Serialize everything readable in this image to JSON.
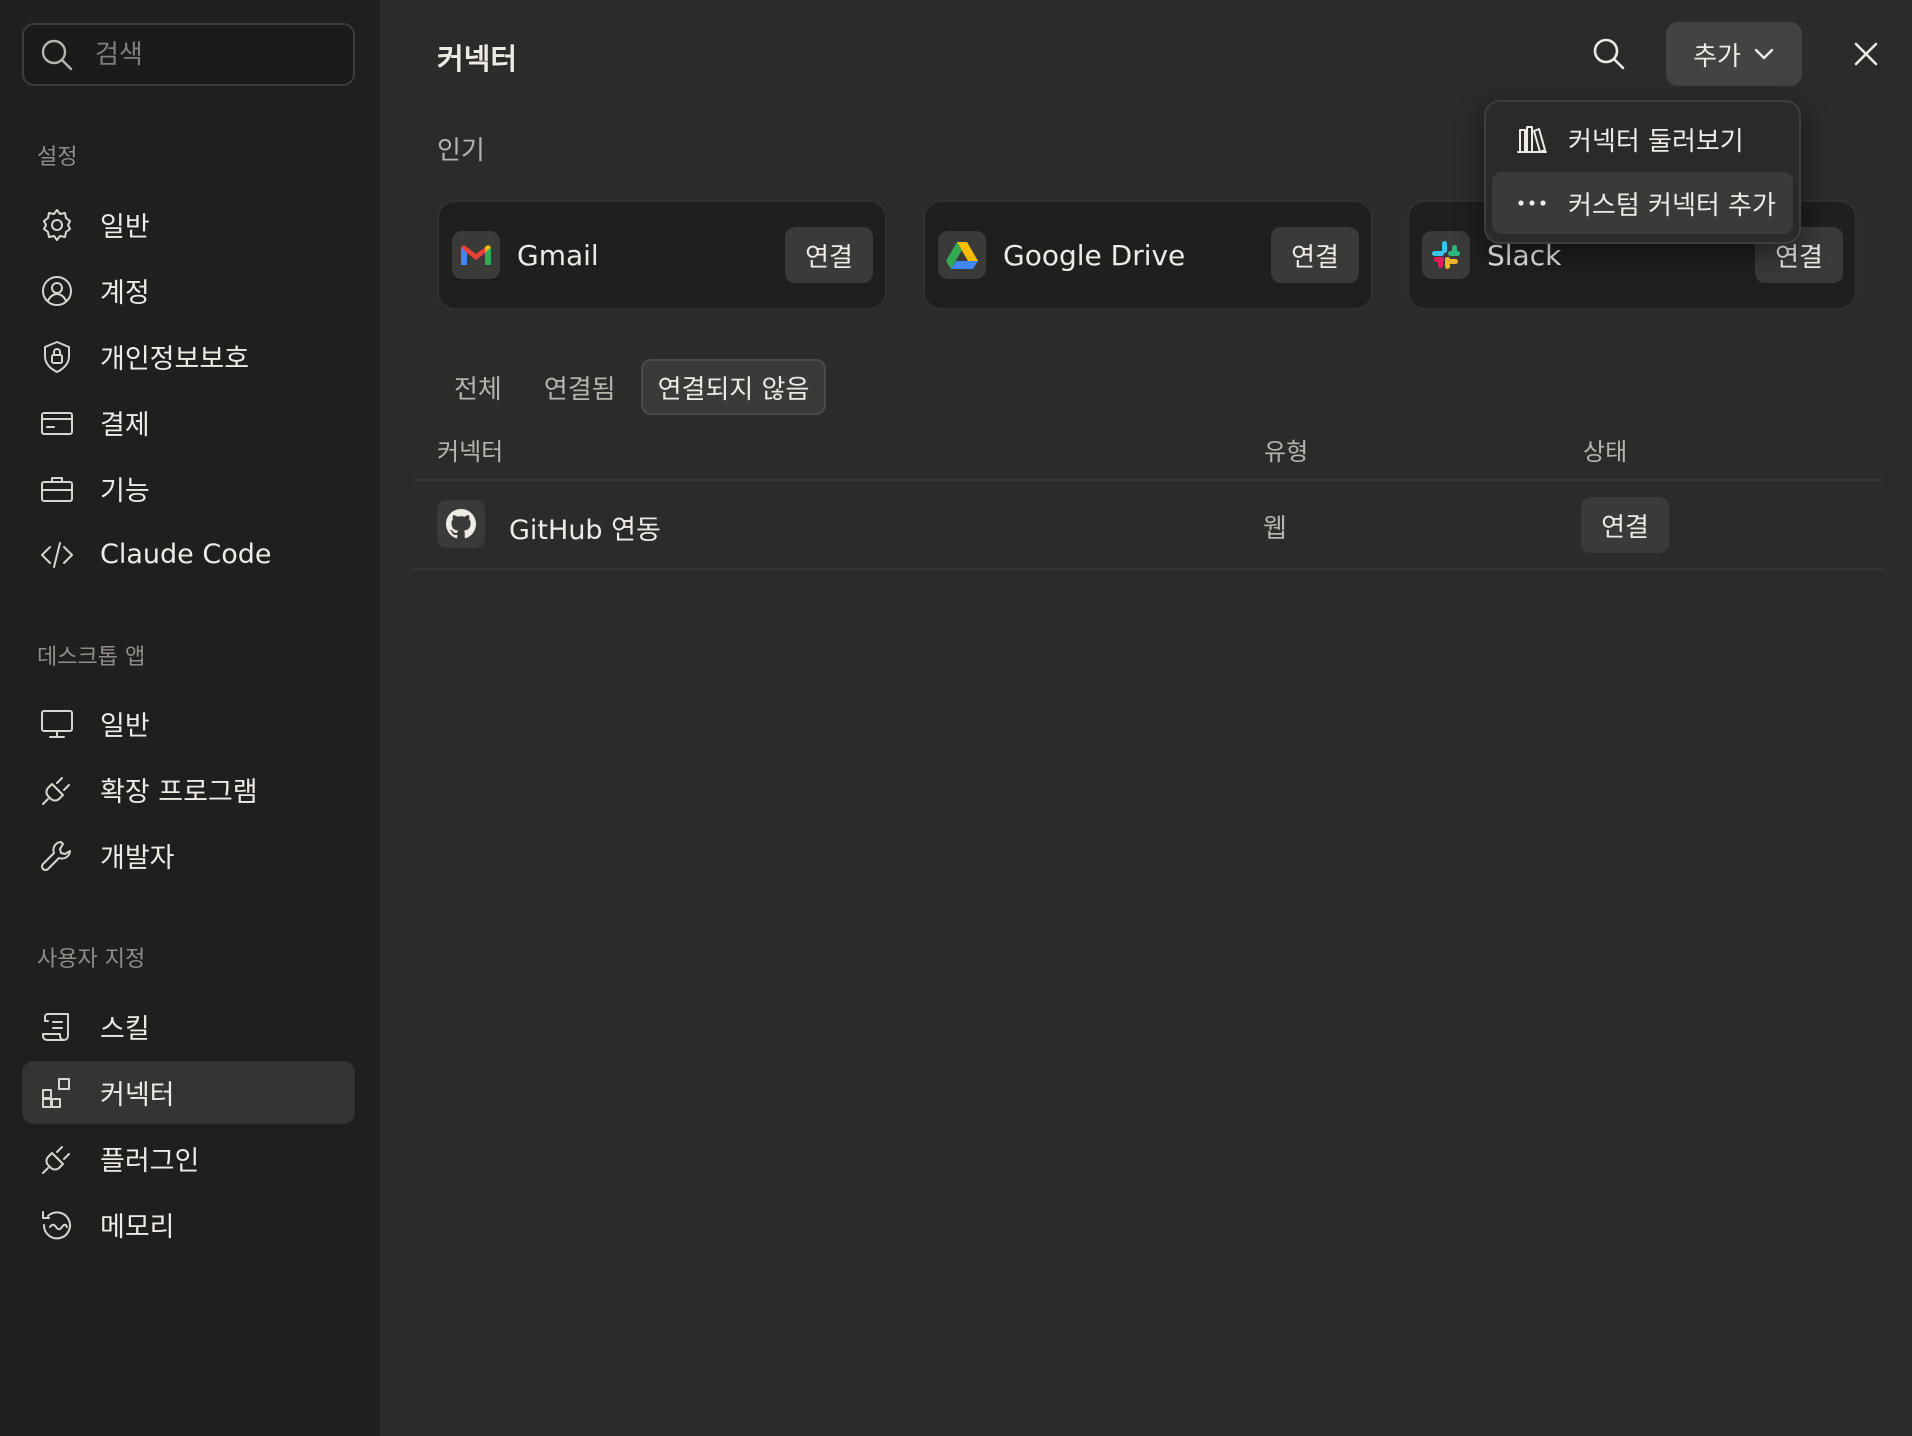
{
  "sidebar": {
    "search": {
      "placeholder": "검색"
    },
    "sections": [
      {
        "label": "설정"
      },
      {
        "label": "데스크톱 앱"
      },
      {
        "label": "사용자 지정"
      }
    ],
    "settings_items": [
      {
        "label": "일반",
        "icon": "gear-icon"
      },
      {
        "label": "계정",
        "icon": "user-circle-icon"
      },
      {
        "label": "개인정보보호",
        "icon": "shield-lock-icon"
      },
      {
        "label": "결제",
        "icon": "credit-card-icon"
      },
      {
        "label": "기능",
        "icon": "briefcase-icon"
      },
      {
        "label": "Claude Code",
        "icon": "code-icon"
      }
    ],
    "desktop_items": [
      {
        "label": "일반",
        "icon": "monitor-icon"
      },
      {
        "label": "확장 프로그램",
        "icon": "plug-icon"
      },
      {
        "label": "개발자",
        "icon": "wrench-icon"
      }
    ],
    "custom_items": [
      {
        "label": "스킬",
        "icon": "scroll-icon"
      },
      {
        "label": "커넥터",
        "icon": "grid-plus-icon",
        "active": true
      },
      {
        "label": "플러그인",
        "icon": "plug-icon"
      },
      {
        "label": "메모리",
        "icon": "history-icon"
      }
    ]
  },
  "main": {
    "title": "커넥터",
    "add_button": "추가",
    "popular_label": "인기",
    "popular": [
      {
        "name": "Gmail",
        "action": "연결",
        "icon": "gmail-icon"
      },
      {
        "name": "Google Drive",
        "action": "연결",
        "icon": "google-drive-icon"
      },
      {
        "name": "Slack",
        "action": "연결",
        "icon": "slack-icon"
      }
    ],
    "tabs": [
      {
        "label": "전체"
      },
      {
        "label": "연결됨"
      },
      {
        "label": "연결되지 않음",
        "active": true
      }
    ],
    "table": {
      "columns": [
        "커넥터",
        "유형",
        "상태"
      ],
      "rows": [
        {
          "name": "GitHub 연동",
          "type": "웹",
          "status": "연결",
          "icon": "github-icon"
        }
      ]
    }
  },
  "dropdown": {
    "items": [
      {
        "label": "커넥터 둘러보기",
        "icon": "library-icon"
      },
      {
        "label": "커스텀 커넥터 추가",
        "icon": "more-horizontal-icon"
      }
    ]
  },
  "colors": {
    "sidebar_bg": "#1f1f1e",
    "main_bg": "#2b2b2a",
    "button_bg": "#3a3a38",
    "text": "#ecebe6"
  }
}
